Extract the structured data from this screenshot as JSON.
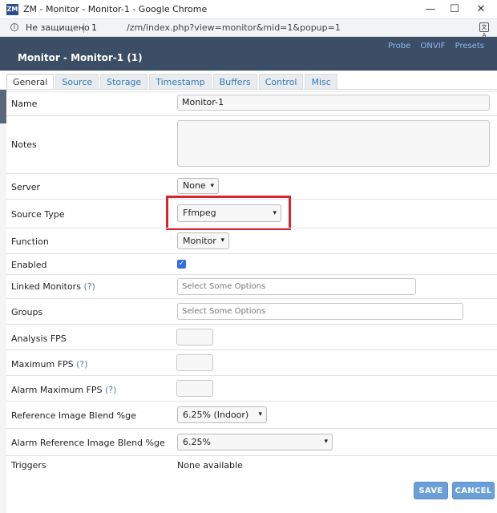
{
  "window": {
    "logo_text": "ZM",
    "title": "ZM - Monitor - Monitor-1 - Google Chrome",
    "minimize": "—",
    "maximize": "☐",
    "close": "✕"
  },
  "address": {
    "security_text": "Не защищено",
    "host": "1",
    "path": "/zm/index.php?view=monitor&mid=1&popup=1"
  },
  "header": {
    "links": [
      "Probe",
      "ONVIF",
      "Presets"
    ],
    "title": "Monitor - Monitor-1 (1)"
  },
  "tabs": [
    {
      "label": "General",
      "active": true
    },
    {
      "label": "Source"
    },
    {
      "label": "Storage"
    },
    {
      "label": "Timestamp"
    },
    {
      "label": "Buffers"
    },
    {
      "label": "Control"
    },
    {
      "label": "Misc"
    }
  ],
  "form": {
    "name": {
      "label": "Name",
      "value": "Monitor-1"
    },
    "notes": {
      "label": "Notes",
      "value": ""
    },
    "server": {
      "label": "Server",
      "value": "None"
    },
    "source_type": {
      "label": "Source Type",
      "value": "Ffmpeg"
    },
    "function": {
      "label": "Function",
      "value": "Monitor"
    },
    "enabled": {
      "label": "Enabled",
      "checked": true
    },
    "linked_monitors": {
      "label": "Linked Monitors",
      "help": "(?)",
      "placeholder": "Select Some Options"
    },
    "groups": {
      "label": "Groups",
      "placeholder": "Select Some Options"
    },
    "analysis_fps": {
      "label": "Analysis FPS",
      "value": ""
    },
    "maximum_fps": {
      "label": "Maximum FPS",
      "help": "(?)",
      "value": ""
    },
    "alarm_maximum_fps": {
      "label": "Alarm Maximum FPS",
      "help": "(?)",
      "value": ""
    },
    "ref_blend": {
      "label": "Reference Image Blend %ge",
      "value": "6.25% (Indoor)"
    },
    "alarm_ref_blend": {
      "label": "Alarm Reference Image Blend %ge",
      "value": "6.25%"
    },
    "triggers": {
      "label": "Triggers",
      "value": "None available"
    }
  },
  "buttons": {
    "save": "SAVE",
    "cancel": "CANCEL"
  },
  "colors": {
    "header_bg": "#3c4d66",
    "link": "#8fb6ef",
    "highlight": "#d9232e",
    "button": "#6a9fd8"
  }
}
